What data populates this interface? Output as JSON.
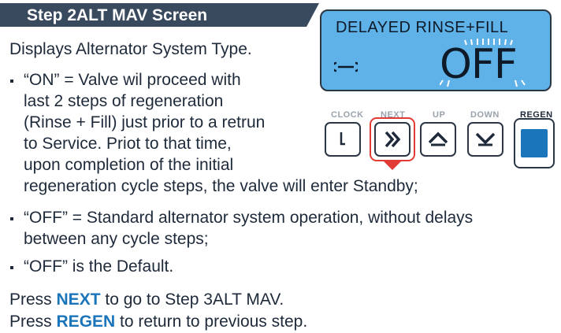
{
  "header": {
    "title": "Step 2ALT MAV Screen"
  },
  "intro": "Displays Alternator System Type.",
  "bullets": {
    "on": [
      "“ON” = Valve wil proceed with",
      "last 2 steps of regeneration",
      "(Rinse + Fill) just prior to a retrun",
      "to Service. Priot to that time,",
      "upon completion of the initial",
      "regeneration cycle steps, the valve will enter Standby;"
    ],
    "off": [
      "“OFF” = Standard alternator system operation, without delays",
      "between any cycle steps;"
    ],
    "default": "“OFF” is the Default."
  },
  "instructions": {
    "next_pre": "Press ",
    "next_kw": "NEXT",
    "next_post": " to go to Step 3ALT MAV.",
    "regen_pre": "Press ",
    "regen_kw": "REGEN",
    "regen_post": " to return to previous step."
  },
  "display": {
    "title": "DELAYED RINSE+FILL",
    "value": "OFF",
    "icon": "wrench-icon"
  },
  "buttons": {
    "clock": "CLOCK",
    "next": "NEXT",
    "up": "UP",
    "down": "DOWN",
    "regen": "REGEN"
  },
  "colors": {
    "header_bg": "#3a4a5e",
    "lcd_bg": "#5eb2e8",
    "keyword": "#1b75bb",
    "highlight": "#e23b36",
    "regen_square": "#1b75bb"
  }
}
